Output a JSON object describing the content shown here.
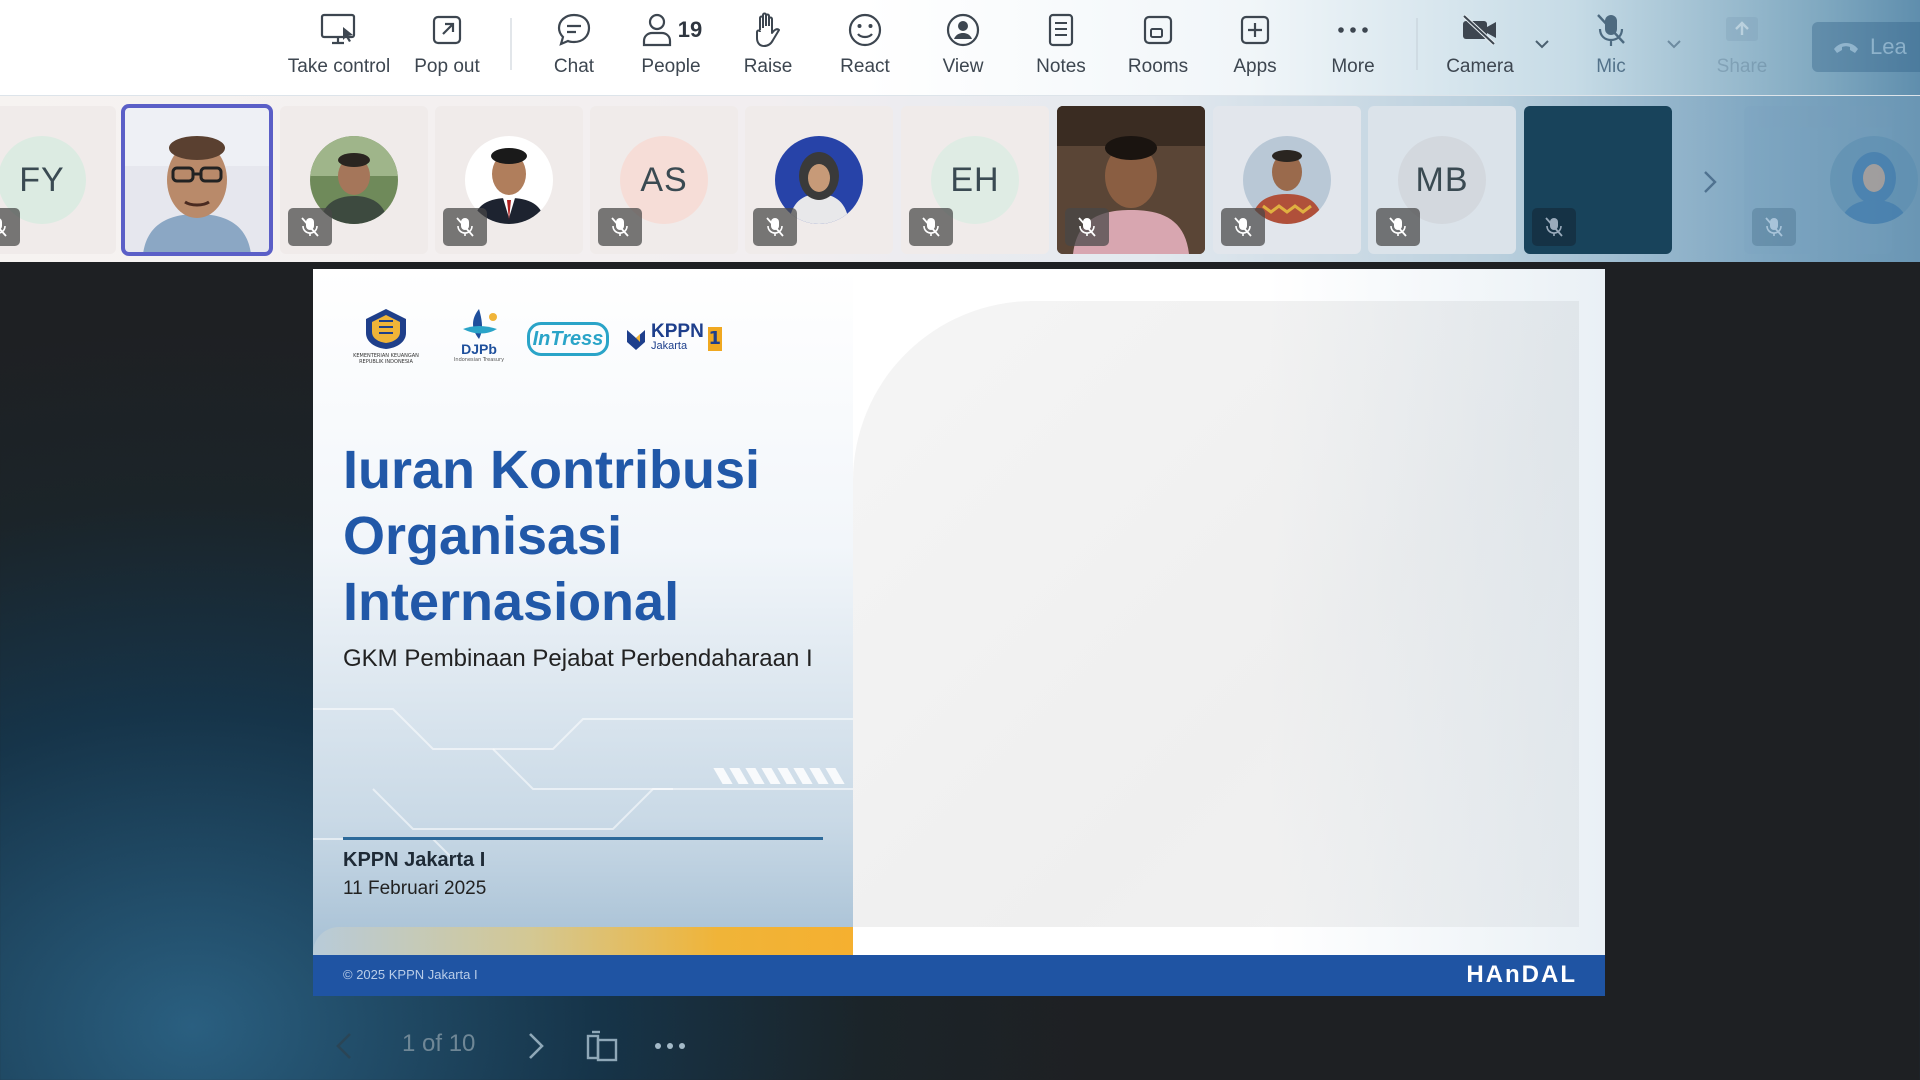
{
  "toolbar": {
    "take_control": "Take control",
    "pop_out": "Pop out",
    "chat": "Chat",
    "people": "People",
    "people_count": "19",
    "raise": "Raise",
    "react": "React",
    "view": "View",
    "notes": "Notes",
    "rooms": "Rooms",
    "apps": "Apps",
    "more": "More",
    "camera": "Camera",
    "mic": "Mic",
    "share": "Share",
    "leave": "Lea"
  },
  "participants": [
    {
      "initials": "FY",
      "bg": "#dcebe2"
    },
    {
      "initials": "",
      "type": "video-selected"
    },
    {
      "initials": "",
      "type": "photo"
    },
    {
      "initials": "",
      "type": "photo"
    },
    {
      "initials": "AS",
      "bg": "#f6ddd7"
    },
    {
      "initials": "",
      "type": "photo"
    },
    {
      "initials": "EH",
      "bg": "#dfece4"
    },
    {
      "initials": "",
      "type": "video"
    },
    {
      "initials": "",
      "type": "photo"
    },
    {
      "initials": "MB",
      "bg": "#e7e2e6"
    },
    {
      "initials": "",
      "type": "empty"
    },
    {
      "initials": "",
      "type": "photo-partial"
    }
  ],
  "slide": {
    "logo_kemenkeu_text": "KEMENTERIAN KEUANGAN REPUBLIK INDONESIA",
    "logo_djpb": "DJPb",
    "logo_djpb_sub": "Indonesian Treasury",
    "logo_intress": "InTress",
    "logo_kppn": "KPPN",
    "logo_kppn_sub": "Jakarta",
    "logo_kppn_num": "1",
    "title": "Iuran Kontribusi Organisasi Internasional",
    "subtitle": "GKM Pembinaan Pejabat Perbendaharaan I",
    "org": "KPPN Jakarta I",
    "date": "11 Februari 2025",
    "footer_copy": "© 2025 KPPN Jakarta I",
    "footer_brand": "HAnDAL"
  },
  "slide_nav": {
    "counter": "1 of 10"
  },
  "colors": {
    "accent": "#5b5fc7",
    "slide_title": "#2158a8",
    "slide_footer": "#1f54a3",
    "gold": "#f0b438"
  }
}
